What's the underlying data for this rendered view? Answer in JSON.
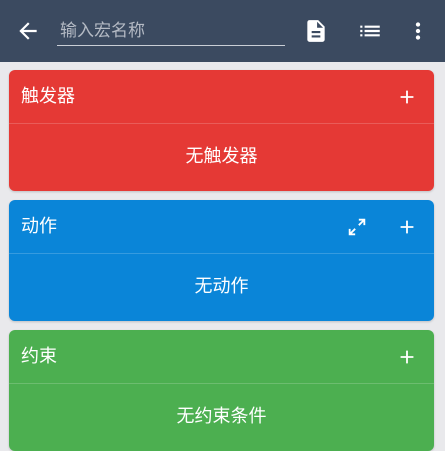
{
  "appbar": {
    "name_placeholder": "输入宏名称",
    "name_value": "",
    "icons": {
      "back": "arrow-left-icon",
      "doc": "document-icon",
      "list": "list-icon",
      "more": "more-vertical-icon"
    },
    "background": "#3b4a60"
  },
  "sections": {
    "triggers": {
      "title": "触发器",
      "empty_text": "无触发器",
      "color": "#e53935",
      "icons": [
        "plus-icon"
      ]
    },
    "actions": {
      "title": "动作",
      "empty_text": "无动作",
      "color": "#0a85d8",
      "icons": [
        "expand-icon",
        "plus-icon"
      ]
    },
    "constraints": {
      "title": "约束",
      "empty_text": "无约束条件",
      "color": "#4caf50",
      "icons": [
        "plus-icon"
      ]
    }
  }
}
